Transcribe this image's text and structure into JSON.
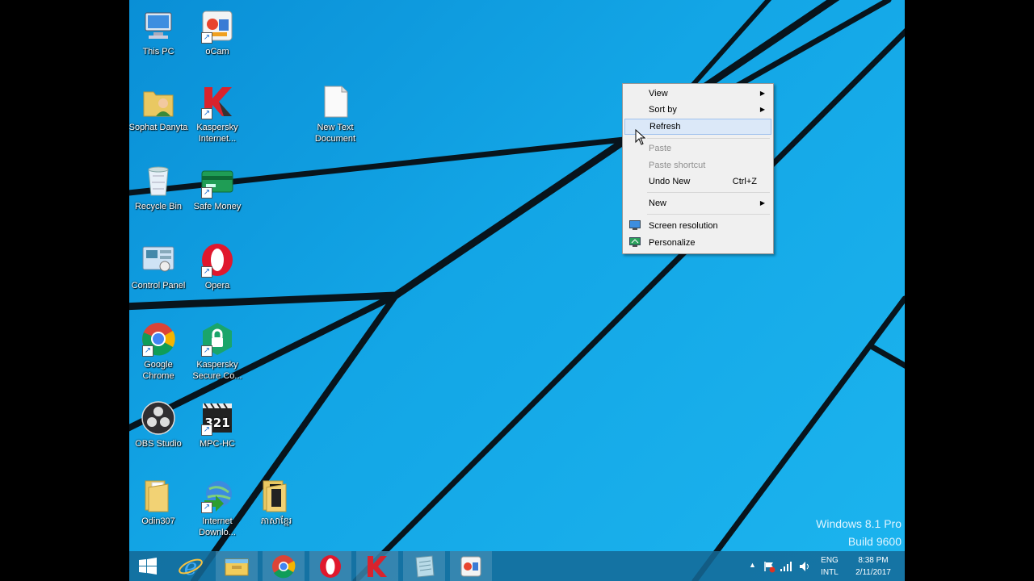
{
  "desktop_icons": [
    {
      "label": "This PC",
      "icon": "this-pc-icon"
    },
    {
      "label": "oCam",
      "icon": "ocam-icon"
    },
    {
      "label": "Sophat Danyta",
      "icon": "user-folder-icon"
    },
    {
      "label": "Kaspersky Internet...",
      "icon": "kaspersky-icon"
    },
    {
      "label": "New Text Document",
      "icon": "text-document-icon"
    },
    {
      "label": "Recycle Bin",
      "icon": "recycle-bin-icon"
    },
    {
      "label": "Safe Money",
      "icon": "safe-money-icon"
    },
    {
      "label": "Control Panel",
      "icon": "control-panel-icon"
    },
    {
      "label": "Opera",
      "icon": "opera-icon"
    },
    {
      "label": "Google Chrome",
      "icon": "chrome-icon"
    },
    {
      "label": "Kaspersky Secure Co...",
      "icon": "kaspersky-secure-icon"
    },
    {
      "label": "OBS Studio",
      "icon": "obs-icon"
    },
    {
      "label": "MPC-HC",
      "icon": "mpc-hc-icon"
    },
    {
      "label": "Odin307",
      "icon": "folder-icon"
    },
    {
      "label": "Internet Downlo...",
      "icon": "idm-icon"
    },
    {
      "label": "ភាសាខ្មែរ",
      "icon": "folder-icon"
    }
  ],
  "context_menu": {
    "items": [
      {
        "label": "View",
        "submenu": true
      },
      {
        "label": "Sort by",
        "submenu": true
      },
      {
        "label": "Refresh",
        "highlighted": true
      },
      {
        "label": "Paste",
        "disabled": true
      },
      {
        "label": "Paste shortcut",
        "disabled": true
      },
      {
        "label": "Undo New",
        "shortcut": "Ctrl+Z"
      },
      {
        "label": "New",
        "submenu": true
      },
      {
        "label": "Screen resolution",
        "icon": "screen-resolution-icon"
      },
      {
        "label": "Personalize",
        "icon": "personalize-icon"
      }
    ]
  },
  "watermark": {
    "line1": "Windows 8.1 Pro",
    "line2": "Build 9600"
  },
  "taskbar": {
    "buttons": [
      "start-icon",
      "internet-explorer-icon",
      "file-explorer-icon",
      "chrome-icon",
      "opera-icon",
      "kaspersky-icon",
      "notepad-icon",
      "ocam-icon"
    ],
    "tray": {
      "lang_top": "ENG",
      "lang_bottom": "INTL",
      "time": "8:38 PM",
      "date": "2/11/2017"
    }
  },
  "colors": {
    "accent": "#1ca7e6",
    "menu_highlight": "#dbe8f8"
  }
}
